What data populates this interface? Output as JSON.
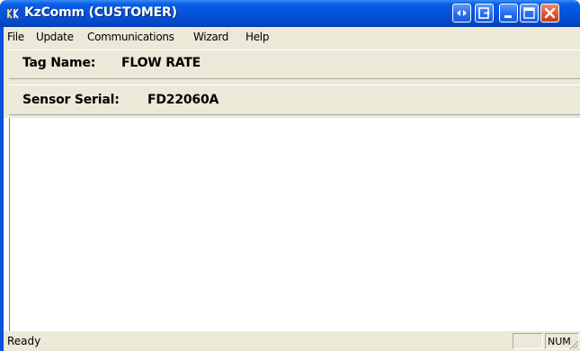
{
  "window": {
    "title": "KzComm (CUSTOMER)"
  },
  "menu": {
    "items": [
      "File",
      "Update",
      "Communications",
      "Wizard",
      "Help"
    ]
  },
  "tag": {
    "label": "Tag Name:",
    "value": "FLOW RATE"
  },
  "sensor": {
    "label": "Sensor Serial:",
    "value": "FD22060A"
  },
  "status": {
    "text": "Ready",
    "num": "NUM"
  },
  "colors": {
    "titlebar": "#0553dc",
    "chrome": "#ece9d8",
    "close_button": "#e05a36"
  },
  "icons": [
    "app-icon",
    "restore-arrows-icon",
    "export-icon",
    "minimize-icon",
    "maximize-icon",
    "close-icon",
    "resize-grip-icon"
  ]
}
